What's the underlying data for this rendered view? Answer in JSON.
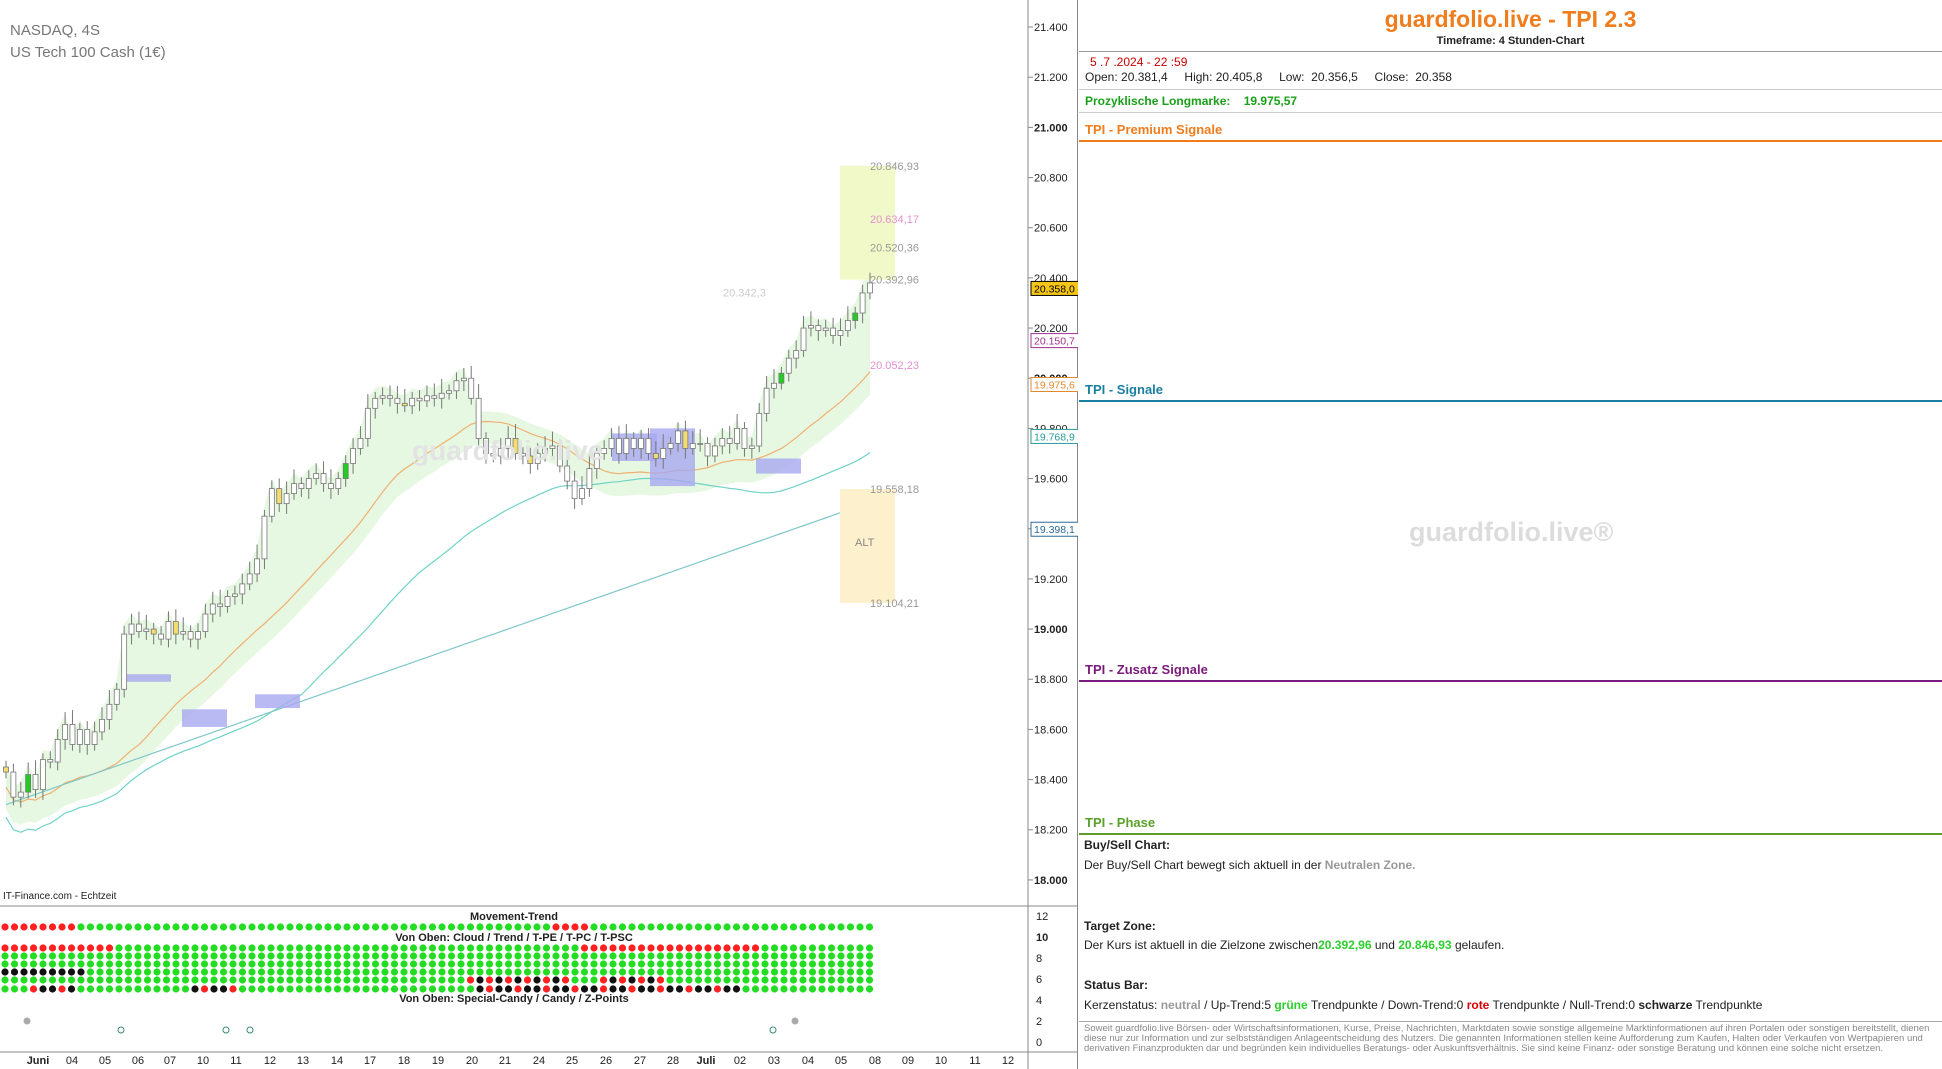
{
  "chart": {
    "symbol": "NASDAQ, 4S",
    "instrument": "US Tech 100 Cash (1€)",
    "source": "IT-Finance.com - Echtzeit",
    "watermark": "guardfolio.live",
    "movement_title": "Movement-Trend",
    "mid_title": "Von Oben: Cloud / Trend / T-PE / T-PC / T-PSC",
    "bottom_title": "Von Oben: Special-Candy / Candy / Z-Points"
  },
  "chart_data": {
    "type": "candlestick",
    "y_ticks": [
      "21.400",
      "21.200",
      "21.000",
      "20.800",
      "20.600",
      "20.400",
      "20.200",
      "20.000",
      "19.800",
      "19.600",
      "19.400",
      "19.200",
      "19.000",
      "18.800",
      "18.600",
      "18.400",
      "18.200",
      "18.000"
    ],
    "y_range": [
      17900,
      21460
    ],
    "x_ticks": [
      "Juni",
      "04",
      "05",
      "06",
      "07",
      "10",
      "11",
      "12",
      "13",
      "14",
      "17",
      "18",
      "19",
      "20",
      "21",
      "24",
      "25",
      "26",
      "27",
      "28",
      "Juli",
      "02",
      "03",
      "04",
      "05",
      "08",
      "09",
      "10",
      "11",
      "12"
    ],
    "price_labels": [
      {
        "text": "20.358,0",
        "value": 20358,
        "bg": "#f5c518",
        "color": "#000"
      },
      {
        "text": "20.150,7",
        "value": 20150,
        "bg": "#fff",
        "color": "#a0308c"
      },
      {
        "text": "19.975,6",
        "value": 19975,
        "bg": "#fff",
        "color": "#e08a30"
      },
      {
        "text": "19.768,9",
        "value": 19768,
        "bg": "#fff",
        "color": "#2a9a9a"
      },
      {
        "text": "19.398,1",
        "value": 19398,
        "bg": "#fff",
        "color": "#2a6a9a"
      }
    ],
    "target_zone": {
      "low": 20392.96,
      "high": 20846.93,
      "labels": [
        "20.846,93",
        "20.634,17",
        "20.520,36",
        "20.392,96"
      ]
    },
    "alt_zone": {
      "low": 19104.21,
      "high": 19558.18,
      "label": "ALT",
      "labels": [
        "19.558,18",
        "19.104,21"
      ]
    },
    "annotations": [
      {
        "text": "20.342,3",
        "value": 20342
      },
      {
        "text": "20.052,23",
        "value": 20052
      }
    ],
    "indicator_ticks": [
      "12",
      "10",
      "8",
      "6",
      "4",
      "2",
      "0"
    ],
    "close_path": [
      18430,
      18330,
      18350,
      18420,
      18360,
      18480,
      18470,
      18560,
      18620,
      18540,
      18600,
      18540,
      18590,
      18640,
      18700,
      18760,
      18980,
      19020,
      18990,
      19000,
      18980,
      18960,
      19030,
      18980,
      18990,
      18960,
      18990,
      19060,
      19100,
      19090,
      19130,
      19140,
      19180,
      19220,
      19280,
      19450,
      19560,
      19500,
      19540,
      19580,
      19560,
      19600,
      19620,
      19580,
      19560,
      19600,
      19660,
      19720,
      19760,
      19880,
      19920,
      19930,
      19920,
      19900,
      19890,
      19920,
      19910,
      19930,
      19920,
      19940,
      19950,
      19990,
      20000,
      19920,
      19760,
      19700,
      19690,
      19720,
      19760,
      19700,
      19690,
      19660,
      19700,
      19720,
      19730,
      19650,
      19590,
      19520,
      19560,
      19640,
      19700,
      19720,
      19760,
      19700,
      19760,
      19720,
      19760,
      19700,
      19680,
      19720,
      19740,
      19790,
      19720,
      19740,
      19740,
      19690,
      19730,
      19760,
      19740,
      19800,
      19720,
      19730,
      19860,
      19960,
      19980,
      20020,
      20080,
      20110,
      20200,
      20210,
      20190,
      20200,
      20170,
      20190,
      20230,
      20260,
      20340,
      20380
    ]
  },
  "panel": {
    "brand": "guardfolio.live - TPI 2.3",
    "timeframe": "Timeframe: 4 Stunden-Chart",
    "date": "5 .7 .2024  - 22 :59",
    "ohlc": "Open: 20.381,4     High: 20.405,8     Low:  20.356,5     Close:  20.358",
    "longmark": "Prozyklische Longmarke:    19.975,57",
    "premium": "TPI - Premium Signale",
    "signale": "TPI - Signale",
    "zusatz": "TPI - Zusatz Signale",
    "phase": "TPI - Phase",
    "watermark": "guardfolio.live®",
    "buysell_label": "Buy/Sell Chart:",
    "buysell_text": "Der Buy/Sell Chart bewegt sich aktuell in der",
    "buysell_zone": "Neutralen Zone.",
    "target_label": "Target Zone:",
    "target_text": "Der Kurs ist aktuell in die Zielzone zwischen",
    "target_low": "20.392,96",
    "target_and": "und",
    "target_high": "20.846,93",
    "target_end": "gelaufen.",
    "status_label": "Status Bar:",
    "status": {
      "prefix": "Kerzenstatus:",
      "neutral": "neutral",
      "up": "/ Up-Trend:5",
      "gruene": "grüne",
      "tp1": "Trendpunkte  / Down-Trend:0",
      "rote": "rote",
      "tp2": "Trendpunkte / Null-Trend:0",
      "schwarze": "schwarze",
      "tp3": "Trendpunkte"
    },
    "disclaimer": "Soweit guardfolio.live Börsen- oder Wirtschaftsinformationen, Kurse, Preise, Nachrichten, Marktdaten sowie sonstige allgemeine Marktinformationen auf ihren Portalen oder sonstigen bereitstellt, dienen diese nur zur Information und zur selbstständigen Anlageentscheidung des Nutzers. Die genannten Informationen stellen keine Aufforderung zum Kaufen, Halten oder Verkaufen von Wertpapieren und derivativen Finanzprodukten dar und begründen kein individuelles Beratungs- oder Auskunftsverhältnis. Sie sind keine Finanz- oder sonstige Beratung und können eine solche nicht ersetzen.",
    "colors": {
      "brand": "#f07c1c",
      "premium": "#f07c1c",
      "signale": "#1a7fa0",
      "zusatz": "#7a1a7a",
      "phase": "#5aa02a"
    }
  }
}
